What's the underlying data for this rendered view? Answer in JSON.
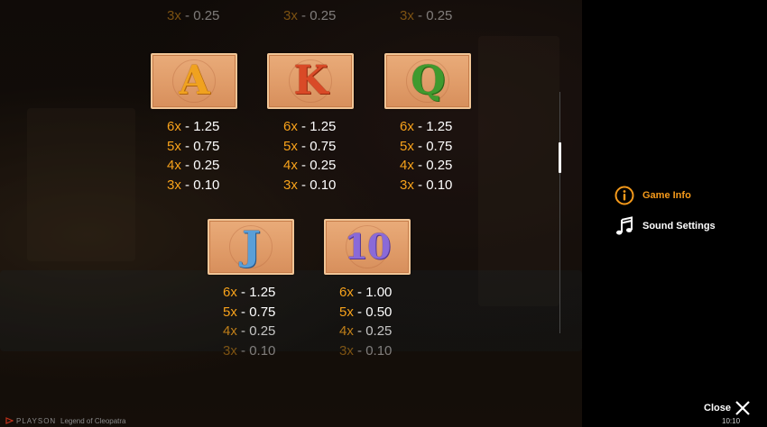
{
  "app": {
    "brand": "PLAYSON",
    "game_title": "Legend of Cleopatra",
    "clock": "10:10"
  },
  "menu": {
    "items": [
      {
        "label": "Game Info",
        "icon": "info-icon",
        "active": true
      },
      {
        "label": "Sound Settings",
        "icon": "music-note-icon",
        "active": false
      }
    ],
    "close_label": "Close"
  },
  "paytable": {
    "top_partial_rows": [
      {
        "count": "3x",
        "sep": " - ",
        "value": "0.25"
      },
      {
        "count": "3x",
        "sep": " - ",
        "value": "0.25"
      },
      {
        "count": "3x",
        "sep": " - ",
        "value": "0.25"
      }
    ],
    "symbols": [
      {
        "symbol": "A",
        "rows": [
          {
            "count": "6x",
            "sep": " - ",
            "value": "1.25"
          },
          {
            "count": "5x",
            "sep": " - ",
            "value": "0.75"
          },
          {
            "count": "4x",
            "sep": " - ",
            "value": "0.25"
          },
          {
            "count": "3x",
            "sep": " - ",
            "value": "0.10"
          }
        ]
      },
      {
        "symbol": "K",
        "rows": [
          {
            "count": "6x",
            "sep": " - ",
            "value": "1.25"
          },
          {
            "count": "5x",
            "sep": " - ",
            "value": "0.75"
          },
          {
            "count": "4x",
            "sep": " - ",
            "value": "0.25"
          },
          {
            "count": "3x",
            "sep": " - ",
            "value": "0.10"
          }
        ]
      },
      {
        "symbol": "Q",
        "rows": [
          {
            "count": "6x",
            "sep": " - ",
            "value": "1.25"
          },
          {
            "count": "5x",
            "sep": " - ",
            "value": "0.75"
          },
          {
            "count": "4x",
            "sep": " - ",
            "value": "0.25"
          },
          {
            "count": "3x",
            "sep": " - ",
            "value": "0.10"
          }
        ]
      },
      {
        "symbol": "J",
        "rows": [
          {
            "count": "6x",
            "sep": " - ",
            "value": "1.25"
          },
          {
            "count": "5x",
            "sep": " - ",
            "value": "0.75"
          },
          {
            "count": "4x",
            "sep": " - ",
            "value": "0.25"
          },
          {
            "count": "3x",
            "sep": " - ",
            "value": "0.10"
          }
        ]
      },
      {
        "symbol": "10",
        "rows": [
          {
            "count": "6x",
            "sep": " - ",
            "value": "1.00"
          },
          {
            "count": "5x",
            "sep": " - ",
            "value": "0.50"
          },
          {
            "count": "4x",
            "sep": " - ",
            "value": "0.25"
          },
          {
            "count": "3x",
            "sep": " - ",
            "value": "0.10"
          }
        ]
      }
    ]
  },
  "colors": {
    "accent": "#f59a1b",
    "multiplier": "#f7a21b",
    "text": "#ffffff",
    "panel": "#000000"
  }
}
